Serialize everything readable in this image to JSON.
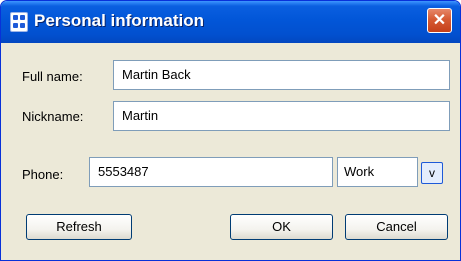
{
  "window": {
    "title": "Personal information",
    "close_glyph": "✕"
  },
  "form": {
    "full_name": {
      "label": "Full name:",
      "value": "Martin Back"
    },
    "nickname": {
      "label": "Nickname:",
      "value": "Martin"
    },
    "phone": {
      "label": "Phone:",
      "value": "5553487",
      "type_selected": "Work",
      "dropdown_glyph": "v"
    }
  },
  "buttons": {
    "refresh": "Refresh",
    "ok": "OK",
    "cancel": "Cancel"
  },
  "colors": {
    "titlebar": "#0256d8",
    "close": "#d65a33",
    "dialog_bg": "#ece9d8",
    "border": "#7f9db9"
  },
  "icons": {
    "app": "app-icon",
    "close": "close-icon",
    "dropdown": "dropdown-arrow"
  }
}
